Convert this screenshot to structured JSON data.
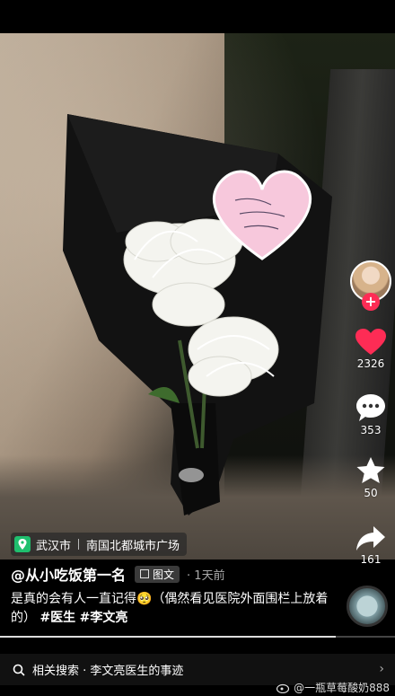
{
  "post": {
    "author": "@从小吃饭第一名",
    "type_badge": "图文",
    "time_ago": "1天前",
    "description_text": "是真的会有人一直记得🥺（偶然看见医院外面围栏上放着的）",
    "hashtags": [
      "#医生",
      "#李文亮"
    ]
  },
  "location": {
    "city": "武汉市",
    "place": "南国北都城市广场"
  },
  "actions": {
    "likes": "2326",
    "comments": "353",
    "favorites": "50",
    "shares": "161"
  },
  "related_search": {
    "label": "相关搜索 · 李文亮医生的事迹"
  },
  "watermark": "一瓶草莓酸奶888",
  "progress": 0.85,
  "colors": {
    "like_red": "#fe2c55",
    "location_green": "#1fbf6e"
  },
  "icons": [
    "location-pin-icon",
    "heart-icon",
    "comment-icon",
    "star-icon",
    "share-icon",
    "search-icon",
    "weibo-icon"
  ]
}
